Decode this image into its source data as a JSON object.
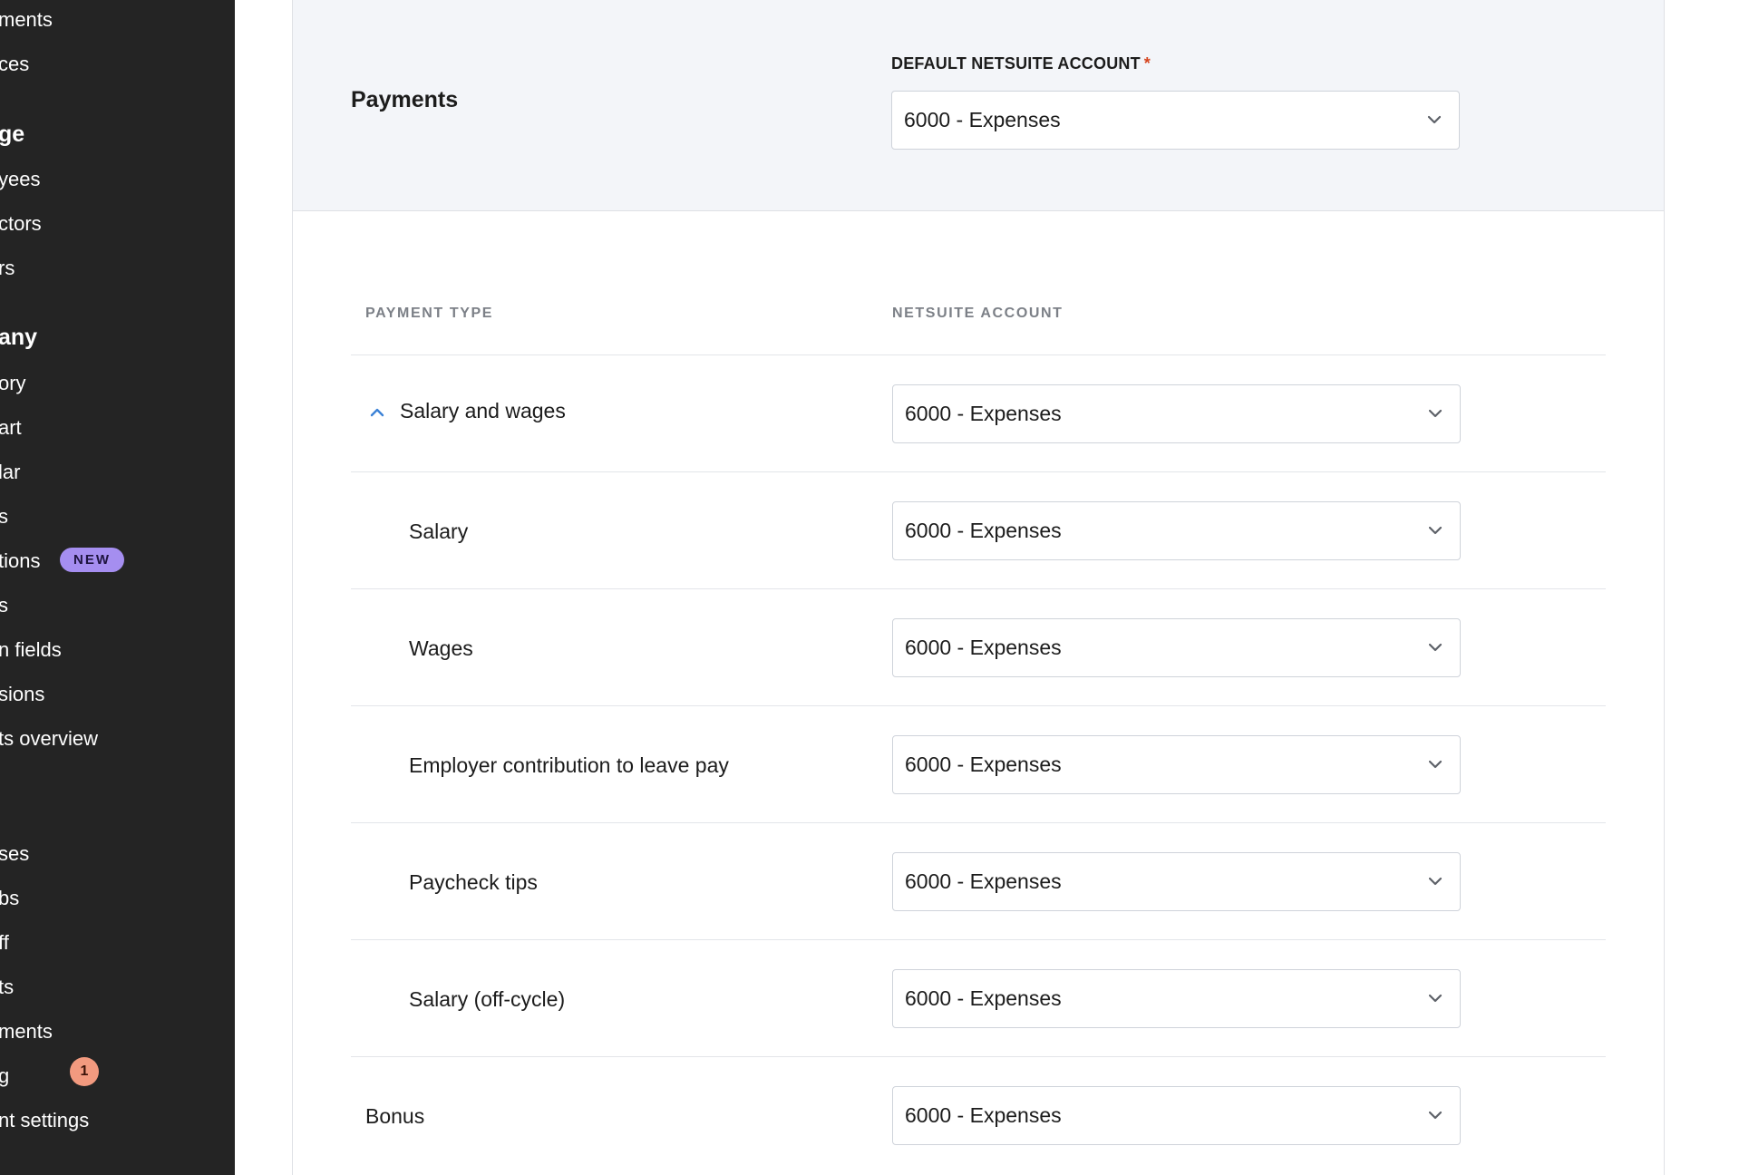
{
  "sidebar": {
    "items": [
      {
        "label": "ments"
      },
      {
        "label": "ces"
      },
      {
        "label": "ge"
      },
      {
        "label": "yees"
      },
      {
        "label": "ctors"
      },
      {
        "label": "rs"
      },
      {
        "label": "any"
      },
      {
        "label": "ory"
      },
      {
        "label": "art"
      },
      {
        "label": "lar"
      },
      {
        "label": "s"
      },
      {
        "label": "tions"
      },
      {
        "label": "s"
      },
      {
        "label": "n fields"
      },
      {
        "label": "sions"
      },
      {
        "label": "ts overview"
      },
      {
        "label": "ses"
      },
      {
        "label": "bs"
      },
      {
        "label": "ff"
      },
      {
        "label": "ts"
      },
      {
        "label": "ments"
      },
      {
        "label": "g"
      },
      {
        "label": "nt settings"
      }
    ],
    "new_badge": "NEW",
    "count_badge": "1"
  },
  "payments_section": {
    "title": "Payments",
    "default_account_label": "DEFAULT NETSUITE ACCOUNT",
    "required_marker": "*",
    "default_account_value": "6000 - Expenses"
  },
  "table": {
    "headers": {
      "payment_type": "PAYMENT TYPE",
      "netsuite_account": "NETSUITE ACCOUNT"
    },
    "rows": [
      {
        "payment_type": "Salary and wages",
        "account": "6000 - Expenses",
        "expanded": true
      },
      {
        "payment_type": "Salary",
        "account": "6000 - Expenses"
      },
      {
        "payment_type": "Wages",
        "account": "6000 - Expenses"
      },
      {
        "payment_type": "Employer contribution to leave pay",
        "account": "6000 - Expenses"
      },
      {
        "payment_type": "Paycheck tips",
        "account": "6000 - Expenses"
      },
      {
        "payment_type": "Salary (off-cycle)",
        "account": "6000 - Expenses"
      },
      {
        "payment_type": "Bonus",
        "account": "6000 - Expenses"
      }
    ]
  },
  "icons": {
    "select_arrow": "chevron-down-icon",
    "group_toggle": "chevron-up-icon"
  },
  "colors": {
    "sidebar_bg": "#242424",
    "new_badge_bg": "#a58ef0",
    "count_badge_bg": "#f29a7f",
    "required_marker": "#d6451f",
    "expand_icon": "#3b82d6",
    "header_band_bg": "#f3f5f9"
  }
}
